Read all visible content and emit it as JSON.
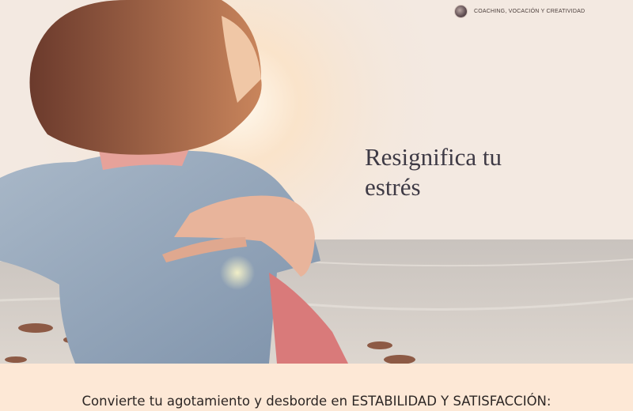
{
  "header": {
    "brand_label": "COACHING, VOCACIÓN Y CREATIVIDAD"
  },
  "hero": {
    "headline": "Resignifica tu estrés"
  },
  "content": {
    "subtitle": "Convierte tu agotamiento y desborde en ESTABILIDAD Y SATISFACCIÓN:"
  },
  "colors": {
    "band": "#fde8d6",
    "headline": "#3e3a45"
  }
}
